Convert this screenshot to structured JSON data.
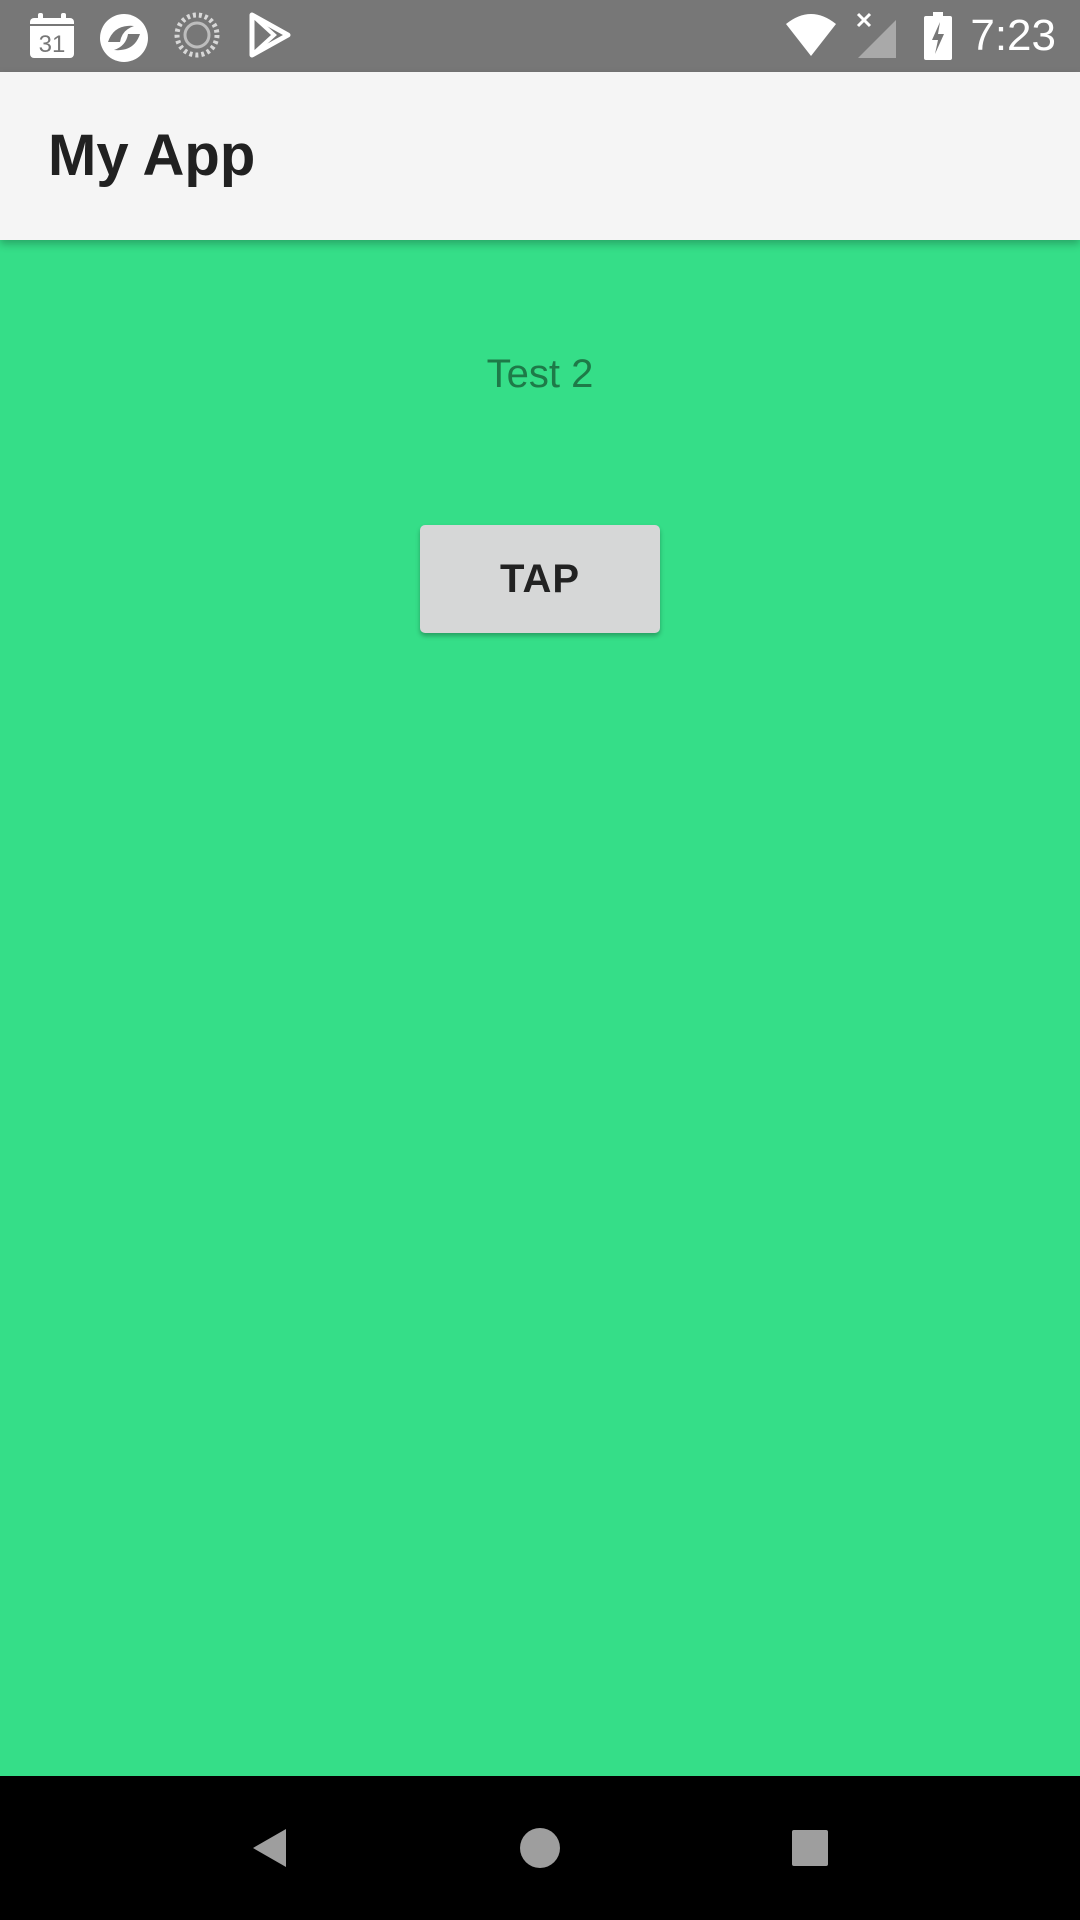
{
  "status_bar": {
    "time": "7:23",
    "calendar_day": "31",
    "icons": [
      "calendar-icon",
      "browser-icon",
      "sync-spinner-icon",
      "play-store-icon",
      "wifi-icon",
      "no-signal-icon",
      "battery-charging-icon"
    ]
  },
  "app_bar": {
    "title": "My App"
  },
  "content": {
    "label": "Test 2",
    "button_label": "TAP"
  },
  "colors": {
    "background": "#35de88",
    "status_bar": "#777777",
    "app_bar": "#f5f5f5",
    "button": "#d6d7d7",
    "label_text": "#1e7a48"
  },
  "nav_bar": {
    "icons": [
      "back-icon",
      "home-icon",
      "recents-icon"
    ]
  }
}
